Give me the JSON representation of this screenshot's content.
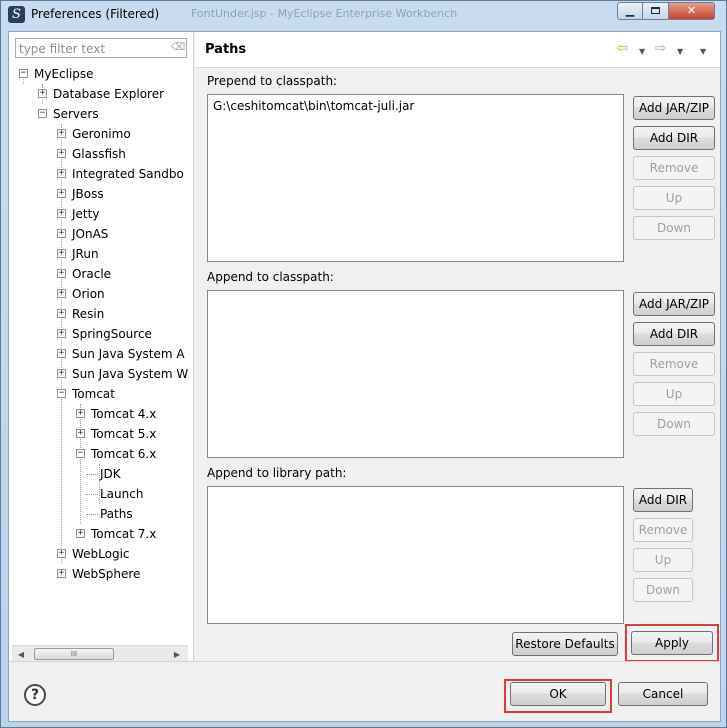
{
  "window": {
    "title": "Preferences (Filtered)",
    "background_title": "FontUnder.jsp - MyEclipse Enterprise Workbench",
    "min_glyph": "▁",
    "close_glyph": "✕"
  },
  "filter": {
    "placeholder": "type filter text"
  },
  "tree": [
    {
      "label": "MyEclipse",
      "expander": "−"
    },
    {
      "label": "Database Explorer",
      "expander": "+"
    },
    {
      "label": "Servers",
      "expander": "−"
    },
    {
      "label": "Geronimo",
      "expander": "+"
    },
    {
      "label": "Glassfish",
      "expander": "+"
    },
    {
      "label": "Integrated Sandbo",
      "expander": "+"
    },
    {
      "label": "JBoss",
      "expander": "+"
    },
    {
      "label": "Jetty",
      "expander": "+"
    },
    {
      "label": "JOnAS",
      "expander": "+"
    },
    {
      "label": "JRun",
      "expander": "+"
    },
    {
      "label": "Oracle",
      "expander": "+"
    },
    {
      "label": "Orion",
      "expander": "+"
    },
    {
      "label": "Resin",
      "expander": "+"
    },
    {
      "label": "SpringSource",
      "expander": "+"
    },
    {
      "label": "Sun Java System A",
      "expander": "+"
    },
    {
      "label": "Sun Java System W",
      "expander": "+"
    },
    {
      "label": "Tomcat",
      "expander": "−"
    },
    {
      "label": "Tomcat  4.x",
      "expander": "+"
    },
    {
      "label": "Tomcat  5.x",
      "expander": "+"
    },
    {
      "label": "Tomcat  6.x",
      "expander": "−"
    },
    {
      "label": "JDK",
      "expander": ""
    },
    {
      "label": "Launch",
      "expander": ""
    },
    {
      "label": "Paths",
      "expander": ""
    },
    {
      "label": "Tomcat  7.x",
      "expander": "+"
    },
    {
      "label": "WebLogic",
      "expander": "+"
    },
    {
      "label": "WebSphere",
      "expander": "+"
    }
  ],
  "scrollbar": {
    "left": "◀",
    "right": "▶",
    "thumb": "III"
  },
  "page": {
    "title": "Paths",
    "back_icon": "⇦",
    "forward_icon": "⇨",
    "dropdown_glyph": "▼"
  },
  "prepend": {
    "label": "Prepend to classpath:",
    "items": [
      "G:\\ceshitomcat\\bin\\tomcat-juli.jar"
    ],
    "buttons": [
      "Add JAR/ZIP",
      "Add DIR",
      "Remove",
      "Up",
      "Down"
    ]
  },
  "append": {
    "label": "Append to classpath:",
    "buttons": [
      "Add JAR/ZIP",
      "Add DIR",
      "Remove",
      "Up",
      "Down"
    ]
  },
  "library": {
    "label": "Append to library path:",
    "buttons": [
      "Add DIR",
      "Remove",
      "Up",
      "Down"
    ]
  },
  "actions": {
    "restore_defaults": "Restore Defaults",
    "apply": "Apply",
    "ok": "OK",
    "cancel": "Cancel",
    "help": "?"
  }
}
